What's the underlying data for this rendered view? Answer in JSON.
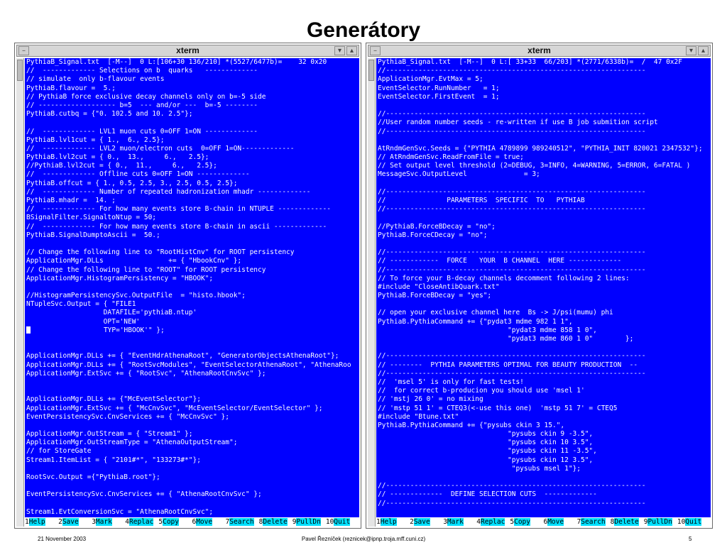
{
  "slide": {
    "title": "Generátory",
    "footer_date": "21 November 2003",
    "footer_author": "Pavel Řezníček (reznicek@ipnp.troja.mff.cuni.cz)",
    "footer_page": "5"
  },
  "colors": {
    "terminal_bg": "#0000ff",
    "terminal_fg": "#ffffff",
    "fkey_label_bg": "#00e0ff"
  },
  "icons": {
    "window_menu": "window-menu-icon",
    "minimize": "minimize-icon",
    "maximize": "maximize-icon"
  },
  "left": {
    "window_title": "xterm",
    "status": "PythiaB_Signal.txt  [-M--]  0 L:[106+30 136/210] *(5527/6477b)=    32 0x20",
    "lines": [
      "//  ------------- Selections on b  quarks   -------------",
      "// simulate  only b-flavour events",
      "PythiaB.flavour =  5.;",
      "// PythiaB force exclusive decay channels only on b=-5 side",
      "// ------------------- b=5  --- and/or ---  b=-5 --------",
      "PythiaB.cutbq = {\"0. 102.5 and 10. 2.5\"};",
      "",
      "//  ------------- LVL1 muon cuts 0=OFF 1=ON -------------",
      "PythiaB.lvl1cut = { 1.,  6., 2.5};",
      "//  ------------- LVL2 muon/electron cuts  0=OFF 1=ON-------------",
      "PythiaB.lvl2cut = { 0.,  13.,     6.,   2.5};",
      "//PythiaB.lvl2cut = { 0.,  11.,     6.,   2.5};",
      "//  ------------- Offline cuts 0=OFF 1=ON -------------",
      "PythiaB.offcut = { 1., 0.5, 2.5, 3., 2.5, 0.5, 2.5};",
      "//  ------------- Number of repeated hadronization mhadr -------------",
      "PythiaB.mhadr =  14. ;",
      "//  ------------- For how many events store B-chain in NTUPLE -------------",
      "BSignalFilter.SignaltoNtup = 50;",
      "//  ------------- For how many events store B-chain in ascii -------------",
      "PythiaB.SignalDumptoAscii =  50.;",
      "",
      "// Change the following line to \"RootHistCnv\" for ROOT persistency",
      "ApplicationMgr.DLLs                += { \"HbookCnv\" };",
      "// Change the following line to \"ROOT\" for ROOT persistency",
      "ApplicationMgr.HistogramPersistency = \"HBOOK\";",
      "",
      "//HistogramPersistencySvc.OutputFile  = \"histo.hbook\";",
      "NTupleSvc.Output = { \"FILE1",
      "                   DATAFILE='pythiaB.ntup'",
      "                   OPT='NEW'",
      "                   TYP='HBOOK'\" };",
      "",
      "",
      "ApplicationMgr.DLLs += { \"EventHdrAthenaRoot\", \"GeneratorObjectsAthenaRoot\"};",
      "ApplicationMgr.DLLs += { \"RootSvcModules\", \"EventSelectorAthenaRoot\", \"AthenaRoo",
      "ApplicationMgr.ExtSvc += { \"RootSvc\", \"AthenaRootCnvSvc\" };",
      "",
      "",
      "ApplicationMgr.DLLs += {\"McEventSelector\"};",
      "ApplicationMgr.ExtSvc += { \"McCnvSvc\", \"McEventSelector/EventSelector\" };",
      "EventPersistencySvc.CnvServices += { \"McCnvSvc\" };",
      "",
      "ApplicationMgr.OutStream = { \"Stream1\" };",
      "ApplicationMgr.OutStreamType = \"AthenaOutputStream\";",
      "// for StoreGate",
      "Stream1.ItemList = { \"2101#*\", \"133273#*\"};",
      "",
      "RootSvc.Output ={\"PythiaB.root\"};",
      "",
      "EventPersistencySvc.CnvServices += { \"AthenaRootCnvSvc\" };",
      "",
      "Stream1.EvtConversionSvc = \"AthenaRootCnvSvc\";"
    ]
  },
  "right": {
    "window_title": "xterm",
    "status": "PythiaB_Signal.txt  [-M--]  0 L:[ 33+33  66/203] *(2771/6338b)=  /  47 0x2F",
    "lines": [
      "//----------------------------------------------------------------",
      "ApplicationMgr.EvtMax = 5;",
      "EventSelector.RunNumber   = 1;",
      "EventSelector.FirstEvent  = 1;",
      "",
      "//----------------------------------------------------------------",
      "//User random number seeds - re-written if use B job submition script",
      "//----------------------------------------------------------------",
      "",
      "AtRndmGenSvc.Seeds = {\"PYTHIA 4789899 989240512\", \"PYTHIA_INIT 820021 2347532\"};",
      "// AtRndmGenSvc.ReadFromFile = true;",
      "// Set output level threshold (2=DEBUG, 3=INFO, 4=WARNING, 5=ERROR, 6=FATAL )",
      "MessageSvc.OutputLevel              = 3;",
      "",
      "//----------------------------------------------------------------",
      "//               PARAMETERS  SPECIFIC  TO   PYTHIAB",
      "//----------------------------------------------------------------",
      "",
      "//PythiaB.ForceBDecay = \"no\";",
      "PythiaB.ForceCDecay = \"no\";",
      "",
      "//----------------------------------------------------------------",
      "// ------------  FORCE   YOUR  B CHANNEL  HERE -------------",
      "//----------------------------------------------------------------",
      "// To force your B-decay channels decomment following 2 lines:",
      "#include \"CloseAntibQuark.txt\"",
      "PythiaB.ForceBDecay = \"yes\";",
      "",
      "// open your exclusive channel here  Bs -> J/psi(mumu) phi",
      "PythiaB.PythiaCommand += {\"pydat3 mdme 982 1 1\",",
      "                                \"pydat3 mdme 858 1 0\",",
      "                                \"pydat3 mdme 860 1 0\"        };",
      "",
      "//----------------------------------------------------------------",
      "// --------  PYTHIA PARAMETERS OPTIMAL FOR BEAUTY PRODUCTION  --",
      "//----------------------------------------------------------------",
      "//  'msel 5' is only for fast tests!",
      "//  for correct b-producion you should use 'msel 1'",
      "// 'mstj 26 0' = no mixing",
      "// 'mstp 51 1' = CTEQ3(<-use this one)  'mstp 51 7' = CTEQ5",
      "#include \"Btune.txt\"",
      "PythiaB.PythiaCommand += {\"pysubs ckin 3 15.\",",
      "                                \"pysubs ckin 9 -3.5\",",
      "                                \"pysubs ckin 10 3.5\",",
      "                                \"pysubs ckin 11 -3.5\",",
      "                                \"pysubs ckin 12 3.5\",",
      "                                 \"pysubs msel 1\"};",
      "",
      "//----------------------------------------------------------------",
      "// -------------  DEFINE SELECTION CUTS  -------------",
      "//----------------------------------------------------------------"
    ]
  },
  "function_keys": [
    {
      "num": "1",
      "label": "Help"
    },
    {
      "num": "2",
      "label": "Save"
    },
    {
      "num": "3",
      "label": "Mark"
    },
    {
      "num": "4",
      "label": "Replac"
    },
    {
      "num": "5",
      "label": "Copy"
    },
    {
      "num": "6",
      "label": "Move"
    },
    {
      "num": "7",
      "label": "Search"
    },
    {
      "num": "8",
      "label": "Delete"
    },
    {
      "num": "9",
      "label": "PullDn"
    },
    {
      "num": "10",
      "label": "Quit"
    }
  ]
}
